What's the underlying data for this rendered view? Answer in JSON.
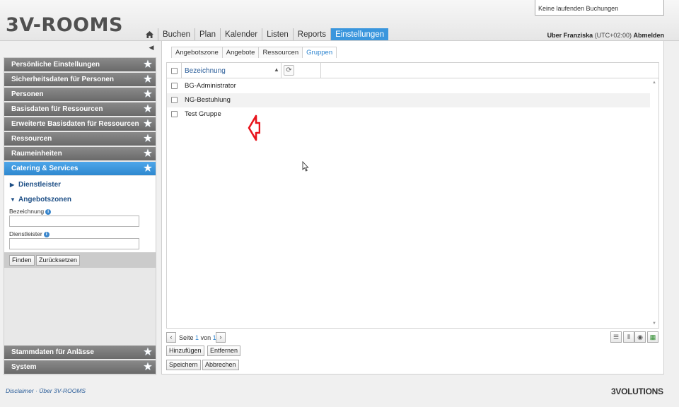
{
  "header": {
    "logo": "3V-ROOMS",
    "booking_status": "Keine laufenden Buchungen",
    "nav": [
      "Buchen",
      "Plan",
      "Kalender",
      "Listen",
      "Reports",
      "Einstellungen"
    ],
    "active_nav": "Einstellungen",
    "user_name": "Uber Franziska",
    "timezone": "(UTC+02:00)",
    "logout": "Abmelden"
  },
  "sidebar": {
    "sections": [
      "Persönliche Einstellungen",
      "Sicherheitsdaten für Personen",
      "Personen",
      "Basisdaten für Ressourcen",
      "Erweiterte Basisdaten für Ressourcen",
      "Ressourcen",
      "Raumeinheiten",
      "Catering & Services"
    ],
    "active_section": "Catering & Services",
    "catering": {
      "dienstleister": "Dienstleister",
      "angebotszonen": "Angebotszonen",
      "bezeichnung_label": "Bezeichnung",
      "bezeichnung_value": "",
      "dienstleister_label": "Dienstleister",
      "dienstleister_value": "",
      "find_button": "Finden",
      "reset_button": "Zurücksetzen"
    },
    "bottom_sections": [
      "Stammdaten für Anlässe",
      "System"
    ]
  },
  "content": {
    "subtabs": [
      "Angebotszone",
      "Angebote",
      "Ressourcen",
      "Gruppen"
    ],
    "active_subtab": "Gruppen",
    "column_header": "Bezeichnung",
    "rows": [
      "BG-Administrator",
      "NG-Bestuhlung",
      "Test Gruppe"
    ],
    "pager": {
      "prefix": "Seite",
      "page": "1",
      "of_label": "von",
      "total": "1"
    },
    "buttons": {
      "add": "Hinzufügen",
      "remove": "Entfernen",
      "save": "Speichern",
      "cancel": "Abbrechen"
    }
  },
  "footer": {
    "disclaimer": "Disclaimer",
    "separator": "·",
    "about": "Über 3V-ROOMS",
    "brand": "3VOLUTIONS"
  },
  "colors": {
    "accent": "#3a96dd",
    "annotation": "#e8141c"
  }
}
